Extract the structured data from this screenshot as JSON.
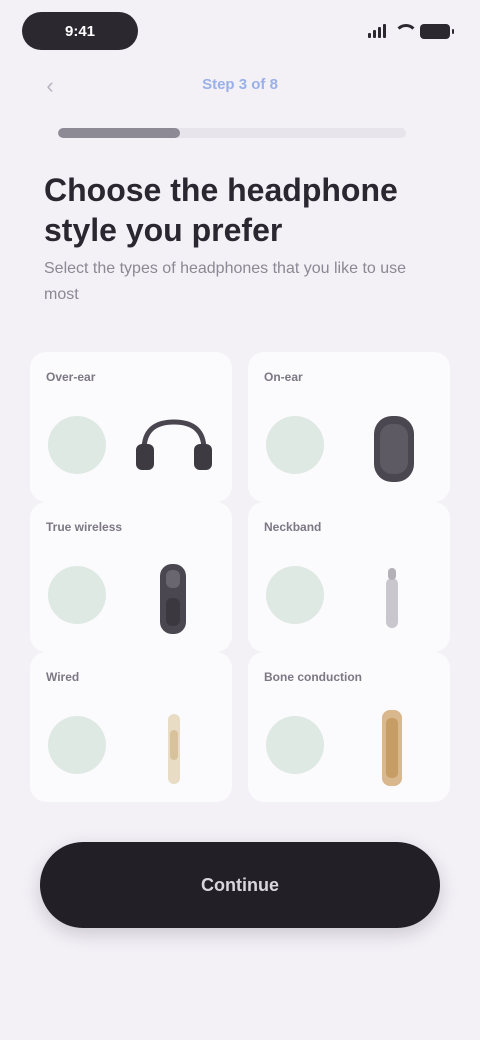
{
  "status_bar": {
    "time": "9:41"
  },
  "nav": {
    "title": "Step 3 of 8",
    "back_icon": "chevron-left-icon"
  },
  "progress": {
    "value": 0.35
  },
  "header": {
    "title": "Choose the headphone style you prefer",
    "subtitle": "Select the types of headphones that you like to use most"
  },
  "options": [
    {
      "label": "Over-ear",
      "image_icon": "over-ear-headphones-icon"
    },
    {
      "label": "On-ear",
      "image_icon": "on-ear-headphones-icon"
    },
    {
      "label": "True wireless",
      "image_icon": "true-wireless-earbuds-icon"
    },
    {
      "label": "Neckband",
      "image_icon": "neckband-earphones-icon"
    },
    {
      "label": "Wired",
      "image_icon": "wired-earphones-icon"
    },
    {
      "label": "Bone conduction",
      "image_icon": "bone-conduction-icon"
    }
  ],
  "colors": {
    "background": "#f3f0f6",
    "card": "#fbfafd",
    "radio": "#dfe9e3",
    "button": "#221f27",
    "accent": "#9ab0e8"
  },
  "actions": {
    "continue_label": "Continue"
  }
}
